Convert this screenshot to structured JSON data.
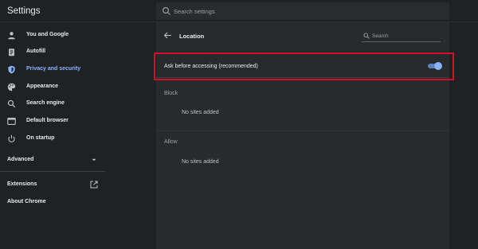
{
  "header": {
    "title": "Settings",
    "search_placeholder": "Search settings"
  },
  "sidebar": {
    "items": [
      {
        "label": "You and Google",
        "icon": "person-icon"
      },
      {
        "label": "Autofill",
        "icon": "clipboard-icon"
      },
      {
        "label": "Privacy and security",
        "icon": "shield-icon",
        "active": true
      },
      {
        "label": "Appearance",
        "icon": "palette-icon"
      },
      {
        "label": "Search engine",
        "icon": "search-icon"
      },
      {
        "label": "Default browser",
        "icon": "browser-icon"
      },
      {
        "label": "On startup",
        "icon": "power-icon"
      }
    ],
    "advanced_label": "Advanced",
    "extensions_label": "Extensions",
    "about_label": "About Chrome"
  },
  "location": {
    "title": "Location",
    "search_placeholder": "Search",
    "ask_label": "Ask before accessing (recommended)",
    "ask_enabled": true,
    "block_heading": "Block",
    "block_empty": "No sites added",
    "allow_heading": "Allow",
    "allow_empty": "No sites added"
  },
  "colors": {
    "background": "#202124",
    "card": "#292a2d",
    "accent": "#8ab4f8",
    "highlight_border": "#d50f25"
  }
}
